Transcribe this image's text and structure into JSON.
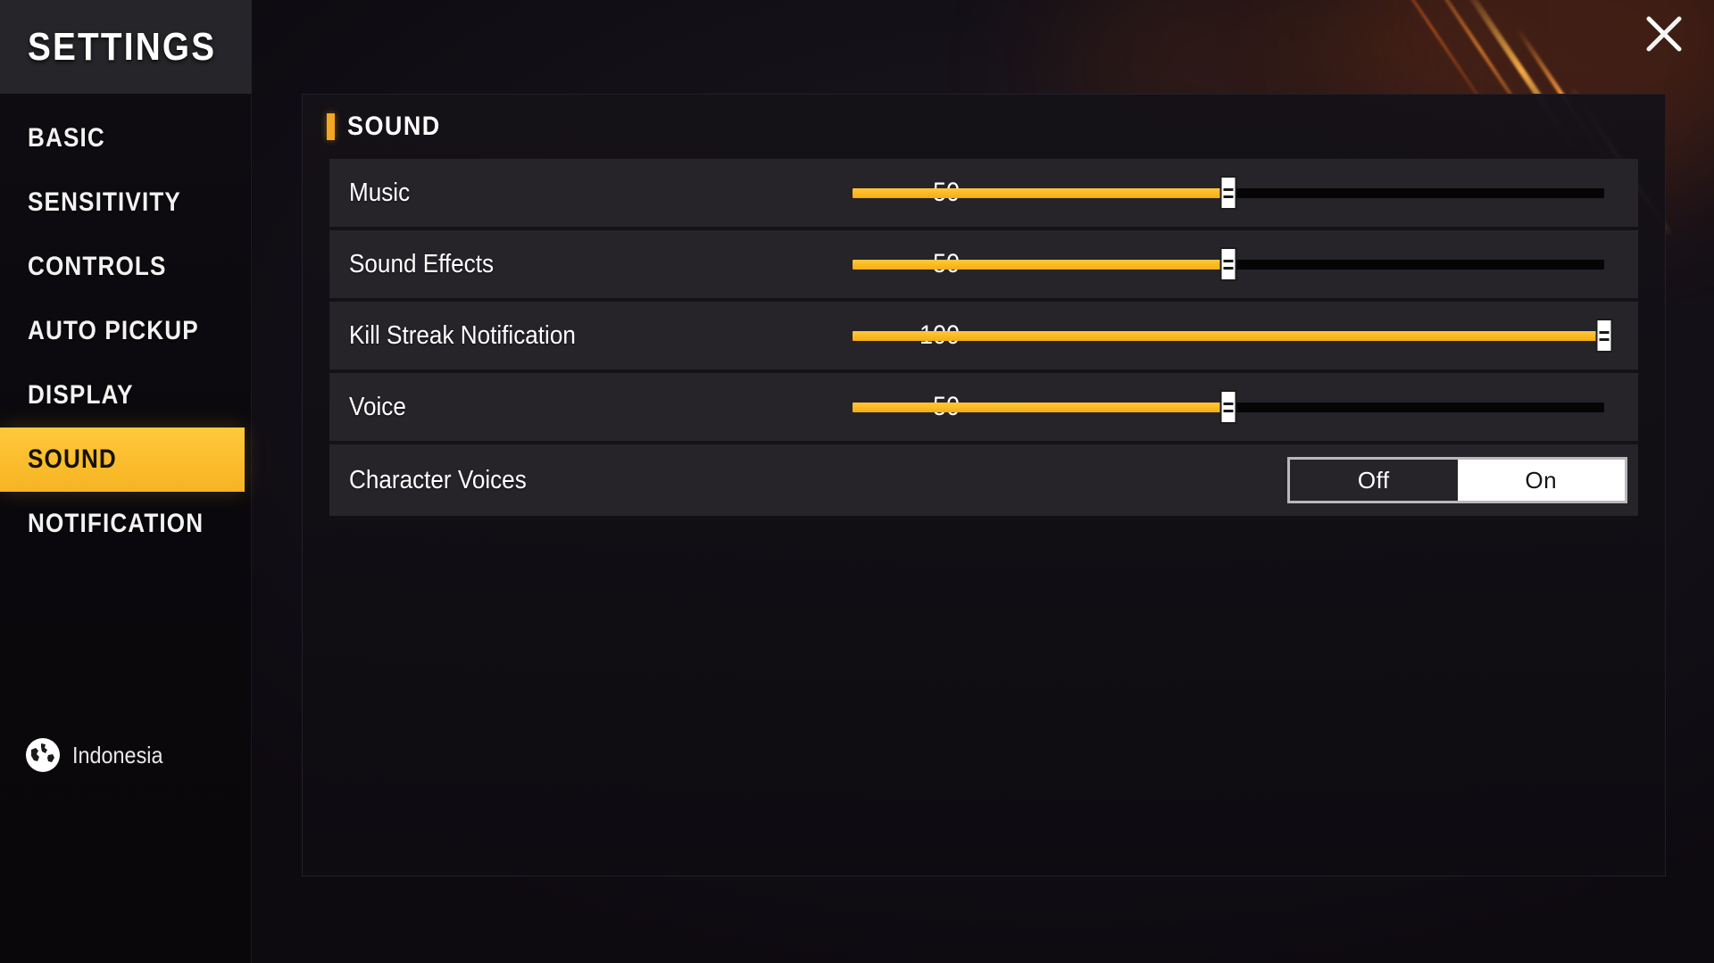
{
  "sidebar": {
    "title": "SETTINGS",
    "items": [
      {
        "label": "BASIC",
        "active": false
      },
      {
        "label": "SENSITIVITY",
        "active": false
      },
      {
        "label": "CONTROLS",
        "active": false
      },
      {
        "label": "AUTO PICKUP",
        "active": false
      },
      {
        "label": "DISPLAY",
        "active": false
      },
      {
        "label": "SOUND",
        "active": true
      },
      {
        "label": "NOTIFICATION",
        "active": false
      }
    ],
    "language": {
      "label": "Indonesia",
      "icon": "globe-icon"
    }
  },
  "window": {
    "close_icon": "close-icon"
  },
  "panel": {
    "title": "SOUND",
    "accent_color": "#f5a623",
    "rows": [
      {
        "label": "Music",
        "value": "50",
        "percent": 50,
        "type": "slider"
      },
      {
        "label": "Sound Effects",
        "value": "50",
        "percent": 50,
        "type": "slider"
      },
      {
        "label": "Kill Streak Notification",
        "value": "100",
        "percent": 100,
        "type": "slider"
      },
      {
        "label": "Voice",
        "value": "50",
        "percent": 50,
        "type": "slider"
      },
      {
        "label": "Character Voices",
        "value": "",
        "type": "toggle",
        "options": [
          {
            "label": "Off",
            "selected": false
          },
          {
            "label": "On",
            "selected": true
          }
        ]
      }
    ]
  },
  "colors": {
    "accent": "#f5a623",
    "slider_fill": "#fcba22",
    "highlight": "#fcbe2e",
    "row_bg": "#262329",
    "panel_bg": "#141117"
  }
}
